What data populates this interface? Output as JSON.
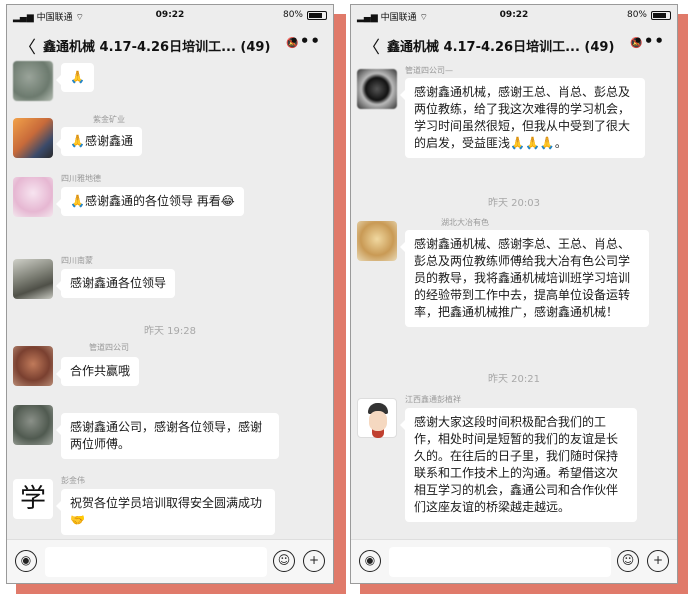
{
  "colors": {
    "accent_shadow": "#e07a6a",
    "chat_background": "#ededed",
    "bubble": "#ffffff"
  },
  "status_bar": {
    "carrier": "中国联通",
    "time": "09:22",
    "battery": "80%"
  },
  "chat": {
    "title": "鑫通机械 4.17-4.26日培训工...",
    "member_count": "(49)"
  },
  "icons": {
    "back": "chevron-left-icon",
    "mute": "bell-mute-icon",
    "more": "more-dots-icon",
    "voice": "voice-icon",
    "emoji": "emoji-icon",
    "add": "plus-circle-icon"
  },
  "left": {
    "messages": [
      {
        "sender": "",
        "text": "🙏",
        "avatar": "blurred-photo"
      },
      {
        "sender": "紫金矿业",
        "text": "🙏感谢鑫通",
        "avatar": "mountain-sunset"
      },
      {
        "sender": "四川雅地德",
        "text": "🙏感谢鑫通的各位领导 再看😂",
        "avatar": "pink-photo"
      },
      {
        "sender": "四川南蒙",
        "text": "感谢鑫通各位领导",
        "avatar": "silhouette-photo"
      }
    ],
    "timestamp": "昨天 19:28",
    "messages2": [
      {
        "sender": "管道四公司",
        "text": "合作共赢哦",
        "avatar": "brown-photo"
      },
      {
        "sender": "",
        "text": "感谢鑫通公司，感谢各位领导，感谢两位师傅。",
        "avatar": "dark-photo"
      },
      {
        "sender": "彭金伟",
        "text": "祝贺各位学员培训取得安全圆满成功🤝",
        "avatar": "calligraphy-char",
        "avatar_char": "学"
      }
    ]
  },
  "right": {
    "message1": {
      "sender": "管道四公司—",
      "text": "感谢鑫通机械，感谢王总、肖总、彭总及两位教练，给了我这次难得的学习机会，学习时间虽然很短，但我从中受到了很大的启发，受益匪浅🙏🙏🙏。",
      "avatar": "bw-photo"
    },
    "timestamp1": "昨天 20:03",
    "message2": {
      "sender": "湖北大冶有色",
      "text": "感谢鑫通机械、感谢李总、王总、肖总、彭总及两位教练师傅给我大冶有色公司学员的教导，我将鑫通机械培训班学习培训的经验带到工作中去，提高单位设备运转率，把鑫通机械推广，感谢鑫通机械！",
      "avatar": "gold-photo"
    },
    "timestamp2": "昨天 20:21",
    "message3": {
      "sender": "江西鑫通彭植祥",
      "text": "感谢大家这段时间积极配合我们的工作，相处时间是短暂的我们的友谊是长久的。在往后的日子里，我们随时保持联系和工作技术上的沟通。希望借这次相互学习的机会，鑫通公司和合作伙伴们这座友谊的桥梁越走越远。",
      "avatar": "cartoon-portrait"
    }
  }
}
